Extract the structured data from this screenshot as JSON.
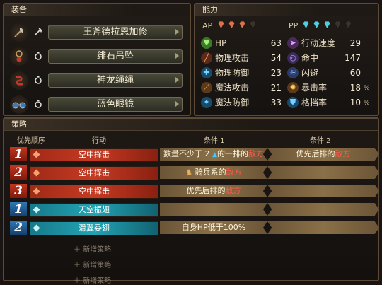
{
  "equipment": {
    "title": "装备",
    "items": [
      {
        "name": "王斧德拉恩加修",
        "icon": "axe-icon",
        "type_icon": "axe-type-icon"
      },
      {
        "name": "绯石吊坠",
        "icon": "pendant-icon",
        "type_icon": "ring-type-icon"
      },
      {
        "name": "神龙绳绳",
        "icon": "dragon-rope-icon",
        "type_icon": "ring-type-icon"
      },
      {
        "name": "蓝色眼镜",
        "icon": "glasses-icon",
        "type_icon": "ring-type-icon"
      }
    ]
  },
  "stats": {
    "title": "能力",
    "ap_label": "AP",
    "pp_label": "PP",
    "ap_gems": {
      "filled": 3,
      "total": 4,
      "color": "#e0704a"
    },
    "pp_gems": {
      "filled": 3,
      "total": 5,
      "color": "#4ad0e0"
    },
    "left": [
      {
        "name": "HP",
        "value": "63",
        "icon": "heart-icon"
      },
      {
        "name": "物理攻击",
        "value": "54",
        "icon": "sword-icon"
      },
      {
        "name": "物理防御",
        "value": "23",
        "icon": "shield-icon"
      },
      {
        "name": "魔法攻击",
        "value": "21",
        "icon": "staff-icon"
      },
      {
        "name": "魔法防御",
        "value": "33",
        "icon": "magic-shield-icon"
      }
    ],
    "right": [
      {
        "name": "行动速度",
        "value": "29",
        "unit": "",
        "icon": "speed-icon"
      },
      {
        "name": "命中",
        "value": "147",
        "unit": "",
        "icon": "target-icon"
      },
      {
        "name": "闪避",
        "value": "60",
        "unit": "",
        "icon": "evade-icon"
      },
      {
        "name": "暴击率",
        "value": "18",
        "unit": "%",
        "icon": "critical-icon"
      },
      {
        "name": "格挡率",
        "value": "10",
        "unit": "%",
        "icon": "block-icon"
      }
    ]
  },
  "strategy": {
    "title": "策略",
    "headers": {
      "priority": "优先顺序",
      "action": "行动",
      "cond1": "条件 1",
      "cond2": "条件 2"
    },
    "rows": [
      {
        "priority": "1",
        "kind": "red",
        "action": "空中挥击",
        "cond1_pre": "数量不少于 2 ",
        "cond1_tri": "▲",
        "cond1_mid": "的一排的",
        "cond1_enemy": "敌方",
        "cond2_pre": "优先后排的",
        "cond2_enemy": "敌方"
      },
      {
        "priority": "2",
        "kind": "red",
        "action": "空中挥击",
        "cond1_pre": "骑兵系的",
        "cond1_enemy": "敌方",
        "cond1_icon": "cavalry-icon"
      },
      {
        "priority": "3",
        "kind": "red",
        "action": "空中挥击",
        "cond1_pre": "优先后排的",
        "cond1_enemy": "敌方"
      },
      {
        "priority": "1",
        "kind": "blue",
        "action": "天空振翅"
      },
      {
        "priority": "2",
        "kind": "blue",
        "action": "滑翼委翅",
        "cond1_pre": "自身HP低于100%"
      }
    ],
    "add_label": "新增策略",
    "add_count": 3
  }
}
